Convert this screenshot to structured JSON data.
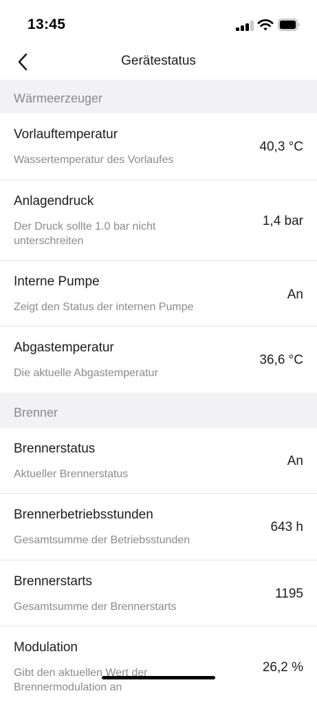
{
  "status_bar": {
    "time": "13:45",
    "signal_icon": "cellular-signal-icon",
    "signal_bars_active": 3,
    "signal_bars_total": 4,
    "wifi_icon": "wifi-icon",
    "battery_icon": "battery-icon",
    "battery_level": 0.85
  },
  "nav": {
    "back_icon": "chevron-left-icon",
    "title": "Gerätestatus"
  },
  "sections": [
    {
      "header": "Wärmeerzeuger",
      "rows": [
        {
          "title": "Vorlauftemperatur",
          "subtitle": "Wassertemperatur des Vorlaufes",
          "value": "40,3 °C"
        },
        {
          "title": "Anlagendruck",
          "subtitle": "Der Druck sollte 1.0 bar nicht unterschreiten",
          "value": "1,4 bar"
        },
        {
          "title": "Interne Pumpe",
          "subtitle": "Zeigt den Status der internen Pumpe",
          "value": "An"
        },
        {
          "title": "Abgastemperatur",
          "subtitle": "Die aktuelle Abgastemperatur",
          "value": "36,6 °C"
        }
      ]
    },
    {
      "header": "Brenner",
      "rows": [
        {
          "title": "Brennerstatus",
          "subtitle": "Aktueller Brennerstatus",
          "value": "An"
        },
        {
          "title": "Brennerbetriebsstunden",
          "subtitle": "Gesamtsumme der Betriebsstunden",
          "value": "643 h"
        },
        {
          "title": "Brennerstarts",
          "subtitle": "Gesamtsumme der Brennerstarts",
          "value": "1195"
        },
        {
          "title": "Modulation",
          "subtitle": "Gibt den aktuellen Wert der Brennermodulation an",
          "value": "26,2 %"
        }
      ]
    }
  ]
}
